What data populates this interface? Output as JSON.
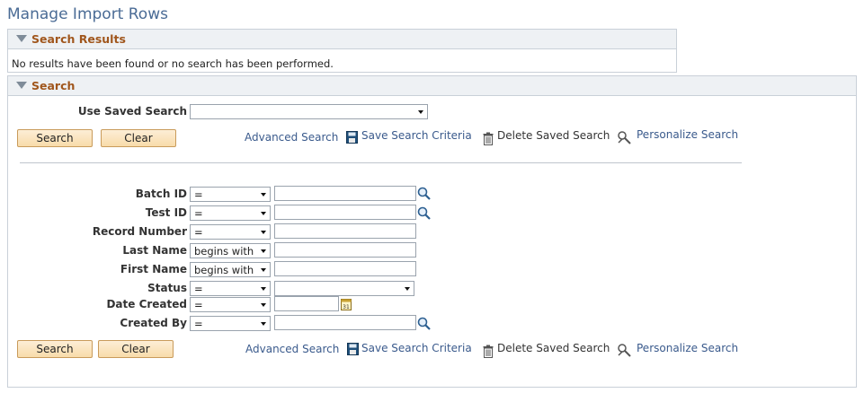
{
  "page": {
    "title": "Manage Import Rows"
  },
  "results": {
    "title": "Search Results",
    "message": "No results have been found or no search has been performed."
  },
  "search": {
    "title": "Search",
    "saved_search_label": "Use Saved Search",
    "saved_search_value": "",
    "search_button": "Search",
    "clear_button": "Clear",
    "advanced_search": "Advanced Search",
    "save_criteria": "Save Search Criteria",
    "delete_saved": "Delete Saved Search",
    "personalize": "Personalize Search",
    "fields": [
      {
        "label": "Batch ID",
        "operator": "=",
        "value": "",
        "lookup_icon": "magnifier-icon"
      },
      {
        "label": "Test ID",
        "operator": "=",
        "value": "",
        "lookup_icon": "magnifier-icon"
      },
      {
        "label": "Record Number",
        "operator": "=",
        "value": ""
      },
      {
        "label": "Last Name",
        "operator": "begins with",
        "value": ""
      },
      {
        "label": "First Name",
        "operator": "begins with",
        "value": ""
      },
      {
        "label": "Status",
        "operator": "=",
        "value": ""
      },
      {
        "label": "Date Created",
        "operator": "=",
        "value": "",
        "lookup_icon": "calendar-icon"
      },
      {
        "label": "Created By",
        "operator": "=",
        "value": "",
        "lookup_icon": "magnifier-icon"
      }
    ]
  },
  "colors": {
    "section_title": "#a0561c",
    "page_title": "#4a6b95",
    "link": "#3a5a8c",
    "button_fill": "#f8dcaa"
  }
}
